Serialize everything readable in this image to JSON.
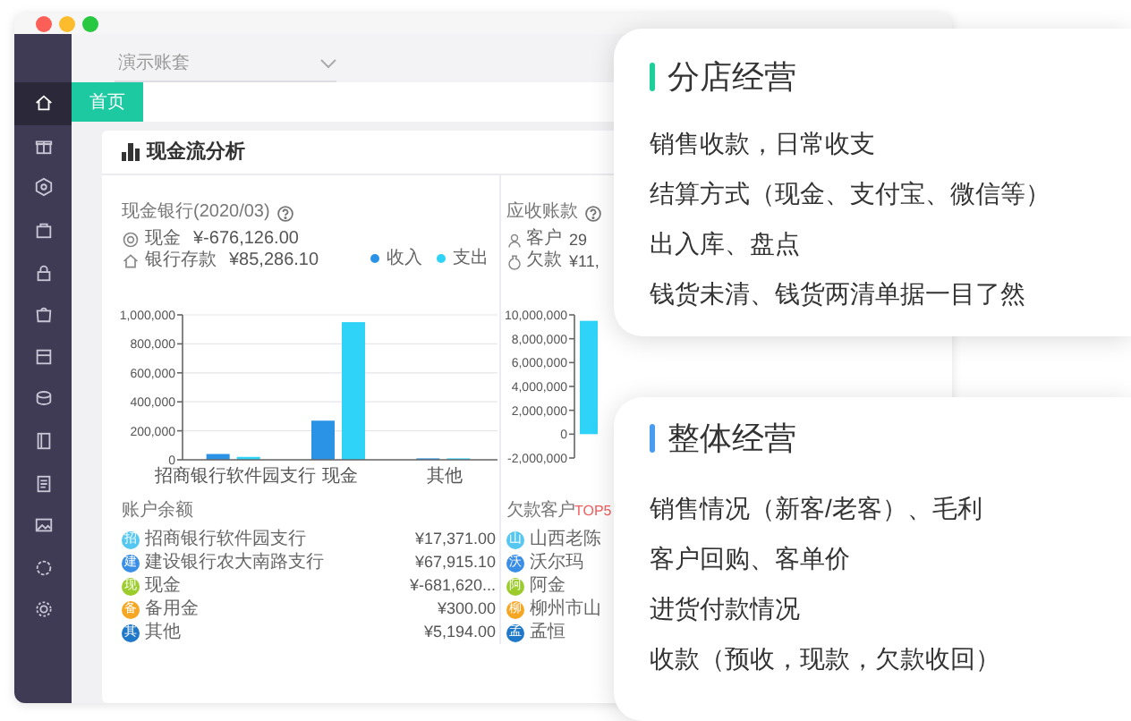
{
  "account_selector": {
    "value": "演示账套"
  },
  "sidebar": {
    "items": [
      {
        "selected": true
      },
      {
        "selected": false
      },
      {
        "selected": false
      },
      {
        "selected": false
      },
      {
        "selected": false
      },
      {
        "selected": false
      },
      {
        "selected": false
      },
      {
        "selected": false
      },
      {
        "selected": false
      },
      {
        "selected": false
      },
      {
        "selected": false
      },
      {
        "selected": false
      },
      {
        "selected": false
      }
    ]
  },
  "tabs": [
    {
      "label": "首页",
      "selected": true
    }
  ],
  "panel": {
    "title": "现金流分析",
    "cash_bank": {
      "title": "现金银行(2020/03)",
      "lines": [
        {
          "label": "现金",
          "value": "¥-676,126.00"
        },
        {
          "label": "银行存款",
          "value": "¥85,286.10"
        }
      ],
      "chart_data": {
        "type": "bar",
        "categories": [
          "招商银行软件园支行",
          "现金",
          "其他"
        ],
        "series": [
          {
            "name": "收入",
            "color": "#2b93e6",
            "values": [
              40000,
              270000,
              0
            ]
          },
          {
            "name": "支出",
            "color": "#2fd3f7",
            "values": [
              20000,
              950000,
              0
            ]
          }
        ],
        "grid": true,
        "ylim": [
          0,
          1000000
        ],
        "yticks": [
          {
            "value": 0,
            "label": "0"
          },
          {
            "value": 200000,
            "label": "200,000"
          },
          {
            "value": 400000,
            "label": "400,000"
          },
          {
            "value": 600000,
            "label": "600,000"
          },
          {
            "value": 800000,
            "label": "800,000"
          },
          {
            "value": 1000000,
            "label": "1,000,000"
          }
        ]
      }
    },
    "accounts": {
      "title": "账户余额",
      "rows": [
        {
          "badge": "招",
          "name": "招商银行软件园支行",
          "amount": "¥17,371.00",
          "color": "#55c7f0"
        },
        {
          "badge": "建",
          "name": "建设银行农大南路支行",
          "amount": "¥67,915.10",
          "color": "#3a8ee6"
        },
        {
          "badge": "现",
          "name": "现金",
          "amount": "¥-681,620...",
          "color": "#9ccc2b"
        },
        {
          "badge": "备",
          "name": "备用金",
          "amount": "¥300.00",
          "color": "#f5a623"
        },
        {
          "badge": "其",
          "name": "其他",
          "amount": "¥5,194.00",
          "color": "#1f78c8"
        }
      ]
    },
    "receivables": {
      "title": "应收账款",
      "lines": [
        {
          "label": "客户",
          "value": "29"
        },
        {
          "label": "欠款",
          "value": "¥11,"
        }
      ],
      "chart_data": {
        "type": "bar",
        "series": [
          {
            "color": "#2fd3f7",
            "values": [
              9500000
            ]
          }
        ],
        "ylim": [
          -2000000,
          10000000
        ],
        "yticks": [
          {
            "value": -2000000,
            "label": "-2,000,000"
          },
          {
            "value": 0,
            "label": "0"
          },
          {
            "value": 2000000,
            "label": "2,000,000"
          },
          {
            "value": 4000000,
            "label": "4,000,000"
          },
          {
            "value": 6000000,
            "label": "6,000,000"
          },
          {
            "value": 8000000,
            "label": "8,000,000"
          },
          {
            "value": 10000000,
            "label": "10,000,000"
          }
        ]
      }
    },
    "top_debtors": {
      "title": "欠款客户",
      "title_highlight": "TOP5",
      "rows": [
        {
          "badge": "山",
          "name": "山西老陈",
          "color": "#55c7f0"
        },
        {
          "badge": "沃",
          "name": "沃尔玛",
          "color": "#3a8ee6"
        },
        {
          "badge": "阿",
          "name": "阿金",
          "color": "#9ccc2b"
        },
        {
          "badge": "柳",
          "name": "柳州市山",
          "color": "#f5a623"
        },
        {
          "badge": "孟",
          "name": "孟恒",
          "color": "#1f78c8"
        }
      ]
    }
  },
  "cards": [
    {
      "title": "分店经营",
      "color": "#1ecf9a",
      "lines": [
        "销售收款，日常收支",
        "结算方式（现金、支付宝、微信等）",
        "出入库、盘点",
        "钱货未清、钱货两清单据一目了然"
      ]
    },
    {
      "title": "整体经营",
      "color": "#4a9cf0",
      "lines": [
        "销售情况（新客/老客）、毛利",
        "客户回购、客单价",
        "进货付款情况",
        "收款（预收，现款，欠款收回）"
      ]
    }
  ]
}
